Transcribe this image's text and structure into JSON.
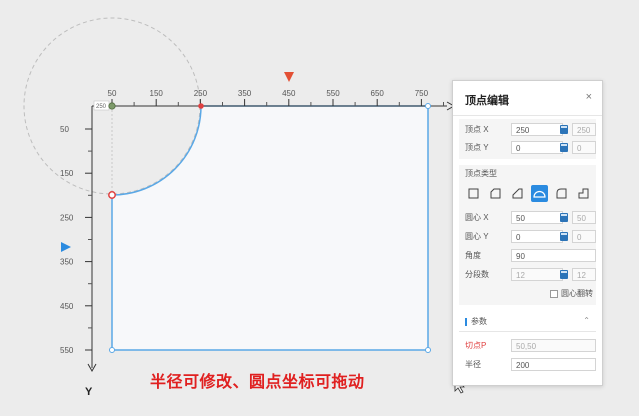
{
  "colors": {
    "accent": "#2b8be0",
    "shape_stroke": "#5aa8e6",
    "shape_fill": "#f7f8fa",
    "vertex_red": "#e04040",
    "caption_red": "#e02020",
    "arrow_red": "#e35035"
  },
  "canvas": {
    "x_axis": {
      "ticks": [
        "50",
        "150",
        "250",
        "350",
        "450",
        "550",
        "650",
        "750"
      ]
    },
    "y_axis": {
      "name": "Y",
      "ticks": [
        "50",
        "150",
        "250",
        "350",
        "450",
        "550"
      ]
    },
    "origin_label": "250",
    "caption": "半径可修改、圆点坐标可拖动"
  },
  "panel": {
    "title": "顶点编辑",
    "close_icon": "close-icon",
    "vertex_x": {
      "label": "顶点 X",
      "value": "250",
      "step": "250"
    },
    "vertex_y": {
      "label": "顶点 Y",
      "value": "0",
      "step": "0"
    },
    "vertex_type": {
      "label": "顶点类型",
      "options": [
        "square-corner",
        "chamfer",
        "inverse-chamfer",
        "round",
        "fillet",
        "step-corner"
      ],
      "selected": "round"
    },
    "center_x": {
      "label": "圆心 X",
      "value": "50",
      "step": "50"
    },
    "center_y": {
      "label": "圆心 Y",
      "value": "0",
      "step": "0"
    },
    "angle": {
      "label": "角度",
      "value": "90"
    },
    "segments": {
      "label": "分段数",
      "value": "12",
      "step": "12"
    },
    "center_flip": {
      "label": "圆心翻转",
      "checked": false
    },
    "params": {
      "label": "参数",
      "tangent_p": {
        "label": "切点P",
        "value": "50,50"
      },
      "radius": {
        "label": "半径",
        "value": "200"
      }
    }
  }
}
